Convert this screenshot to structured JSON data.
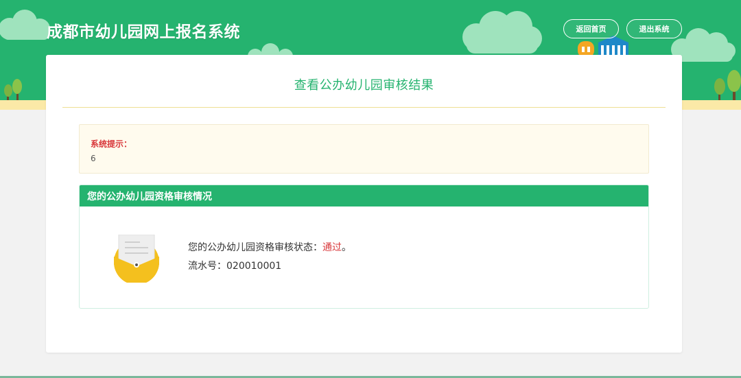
{
  "header": {
    "site_title": "成都市幼儿园网上报名系统",
    "home_button": "返回首页",
    "logout_button": "退出系统"
  },
  "main": {
    "page_title": "查看公办幼儿园审核结果",
    "notice": {
      "label": "系统提示：",
      "value": "6"
    },
    "panel": {
      "heading": "您的公办幼儿园资格审核情况",
      "status_label": "您的公办幼儿园资格审核状态：",
      "status_value": "通过",
      "status_suffix": "。",
      "serial_label": "流水号：",
      "serial_value": "020010001"
    }
  },
  "colors": {
    "brand_green": "#25b36f",
    "alert_red": "#d9383b",
    "ground_yellow": "#fbe9a7",
    "notice_bg": "#fffbee"
  },
  "icons": [
    "cloud-icon",
    "tree-icon",
    "building-icon",
    "document-envelope-icon"
  ]
}
